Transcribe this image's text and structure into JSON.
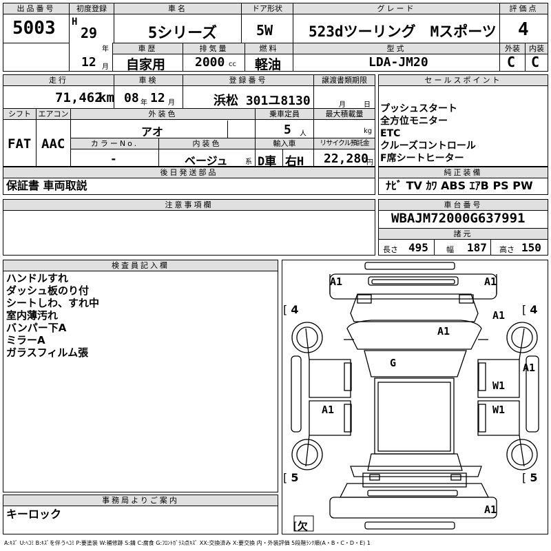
{
  "header": {
    "lot_no_label": "出品番号",
    "lot_no": "5003",
    "first_reg_label": "初度登録",
    "era": "H",
    "year": "29",
    "year_unit": "年",
    "month": "12",
    "month_unit": "月",
    "car_name_label": "車名",
    "car_name": "5シリーズ",
    "door_label": "ドア形状",
    "door": "5W",
    "grade_label": "グレード",
    "grade": "523dツーリング　Mスポーツ",
    "score_label": "評価点",
    "score": "4",
    "history_label": "車歴",
    "history": "自家用",
    "displacement_label": "排気量",
    "displacement": "2000",
    "cc": "cc",
    "fuel_label": "燃料",
    "fuel": "軽油",
    "model_label": "型式",
    "model": "LDA-JM20",
    "exterior_label": "外装",
    "exterior": "C",
    "interior_label": "内装",
    "interior": "C"
  },
  "row2": {
    "mileage_label": "走行",
    "mileage": "71,462",
    "km": "km",
    "inspection_label": "車検",
    "insp_year": "08",
    "insp_year_unit": "年",
    "insp_month": "12",
    "insp_month_unit": "月",
    "plate_label": "登録番号",
    "plate": "浜松 301ユ8130",
    "transfer_label": "譲渡書類期限",
    "transfer_month": "月",
    "transfer_day": "日",
    "sales_label": "セールスポイント",
    "sales_points": [
      "プッシュスタート",
      "全方位モニター",
      "ETC",
      "クルーズコントロール",
      "F席シートヒーター"
    ]
  },
  "row3": {
    "shift_label": "シフト",
    "shift": "FAT",
    "ac_label": "エアコン",
    "ac": "AAC",
    "ext_color_label": "外装色",
    "ext_color": "アオ",
    "capacity_label": "乗車定員",
    "capacity": "5",
    "capacity_unit": "人",
    "load_label": "最大積載量",
    "load_unit": "kg",
    "color_no_label": "カラーNo.",
    "color_no": "-",
    "int_color_label": "内装色",
    "int_color": "ベージュ",
    "int_color_unit": "系",
    "import_label": "輸入車",
    "import_d": "D車",
    "import_side": "右H",
    "recycle_label": "リサイクル預託金",
    "recycle": "22,280",
    "recycle_unit": "円"
  },
  "later_label": "後日発送部品",
  "later_parts": "保証書 車両取説",
  "equip_label": "純正装備",
  "equipment": "ﾅﾋﾞ TV ｶﾜ ABS ｴｱB PS PW",
  "notes_label": "注意事項欄",
  "vin_label": "車台番号",
  "vin": "WBAJM72000G637991",
  "spec_label": "諸元",
  "length_label": "長さ",
  "length": "495",
  "width_label": "幅",
  "width": "187",
  "height_label": "高さ",
  "height": "150",
  "inspector_label": "検査員記入欄",
  "inspector_notes": [
    "ハンドルすれ",
    "ダッシュ板のり付",
    "シートしわ、すれ中",
    "室内薄汚れ",
    "バンパー下A",
    "ミラーA",
    "ガラスフィルム張"
  ],
  "office_label": "事務局よりご案内",
  "office_note": "キーロック",
  "diagram": {
    "tire_fl": "4",
    "tire_fr": "4",
    "tire_rl": "5",
    "tire_rr": "5",
    "spare": "欠",
    "marks": [
      "A1",
      "A1",
      "A1",
      "A1",
      "A1",
      "G",
      "W1",
      "W1",
      "A1",
      "A1",
      "A1"
    ]
  },
  "legend": "A:ｷｽﾞ U:ﾍｺﾐ B:ｷｽﾞを伴うﾍｺﾐ P:要塗装 W:補修跡 S:錆 C:腐食 G:ﾌﾛﾝﾄｶﾞﾗｽ点ｷｽﾞ XX:交換済み X:要交換 内・外装評価 5段階ﾗﾝｸ順(A・B・C・D・E) 1"
}
